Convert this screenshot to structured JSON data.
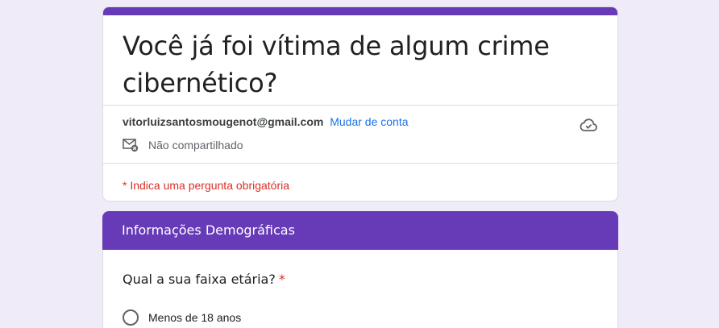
{
  "form": {
    "title": "Você já foi vítima de algum crime cibernético?",
    "account_email": "vitorluizsantosmougenot@gmail.com",
    "switch_account_label": "Mudar de conta",
    "sharing_status": "Não compartilhado",
    "required_note": "* Indica uma pergunta obrigatória"
  },
  "section": {
    "title": "Informações Demográficas"
  },
  "question": {
    "title": "Qual a sua faixa etária?",
    "required_mark": "*",
    "options": [
      "Menos de 18 anos"
    ]
  },
  "colors": {
    "accent": "#673ab7",
    "background": "#efebf8",
    "link": "#1a73e8",
    "required": "#d93025"
  },
  "icons": [
    "cloud-check-icon",
    "mail-unshared-icon"
  ]
}
